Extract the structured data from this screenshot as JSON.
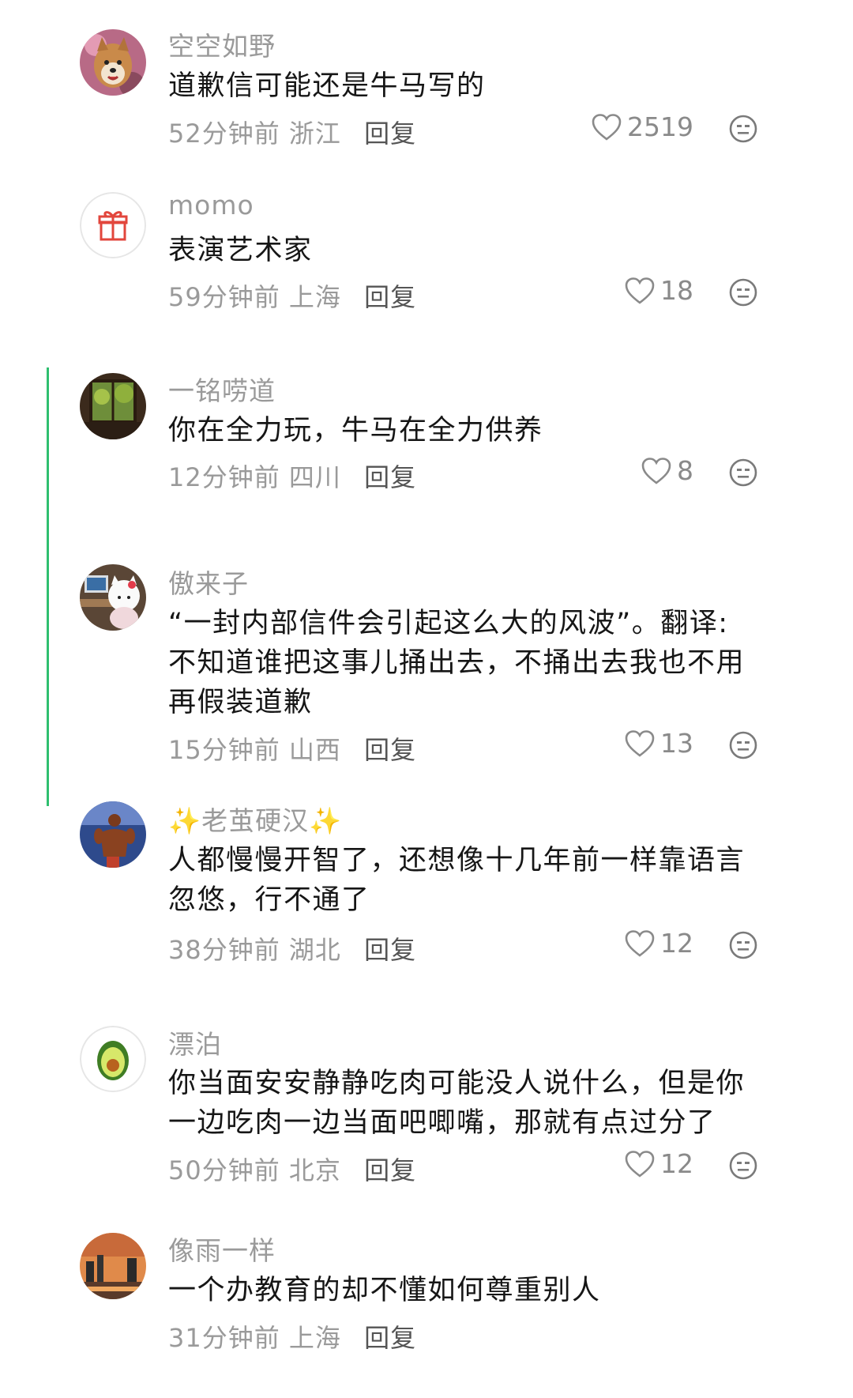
{
  "comments": [
    {
      "username": "空空如野",
      "lines": [
        "道歉信可能还是牛马写的"
      ],
      "time": "52分钟前",
      "location": "浙江",
      "reply": "回复",
      "likes": "2519",
      "avatar": "shiba-dog-avatar"
    },
    {
      "username": "momo",
      "lines": [
        "表演艺术家"
      ],
      "time": "59分钟前",
      "location": "上海",
      "reply": "回复",
      "likes": "18",
      "avatar": "gift-avatar"
    },
    {
      "username": "一铭唠道",
      "lines": [
        "你在全力玩，牛马在全力供养"
      ],
      "time": "12分钟前",
      "location": "四川",
      "reply": "回复",
      "likes": "8",
      "avatar": "window-garden-avatar"
    },
    {
      "username": "傲来子",
      "lines": [
        "“一封内部信件会引起这么大的风波”。翻译:",
        "不知道谁把这事儿捅出去，不捅出去我也不用",
        "再假装道歉"
      ],
      "time": "15分钟前",
      "location": "山西",
      "reply": "回复",
      "likes": "13",
      "avatar": "hello-kitty-desk-avatar"
    },
    {
      "username": "✨老茧硬汉✨",
      "lines": [
        "人都慢慢开智了，还想像十几年前一样靠语言",
        "忽悠，行不通了"
      ],
      "time": "38分钟前",
      "location": "湖北",
      "reply": "回复",
      "likes": "12",
      "avatar": "bodybuilder-avatar"
    },
    {
      "username": "漂泊",
      "lines": [
        "你当面安安静静吃肉可能没人说什么，但是你",
        "一边吃肉一边当面吧唧嘴，那就有点过分了"
      ],
      "time": "50分钟前",
      "location": "北京",
      "reply": "回复",
      "likes": "12",
      "avatar": "avocado-avatar"
    },
    {
      "username": "像雨一样",
      "lines": [
        "一个办教育的却不懂如何尊重别人"
      ],
      "time": "31分钟前",
      "location": "上海",
      "reply": "回复",
      "likes": "",
      "avatar": "sunset-city-avatar"
    }
  ],
  "colors": {
    "thread_line": "#2fbf6f",
    "meta_text": "#9a9a9a",
    "content_text": "#161616"
  }
}
